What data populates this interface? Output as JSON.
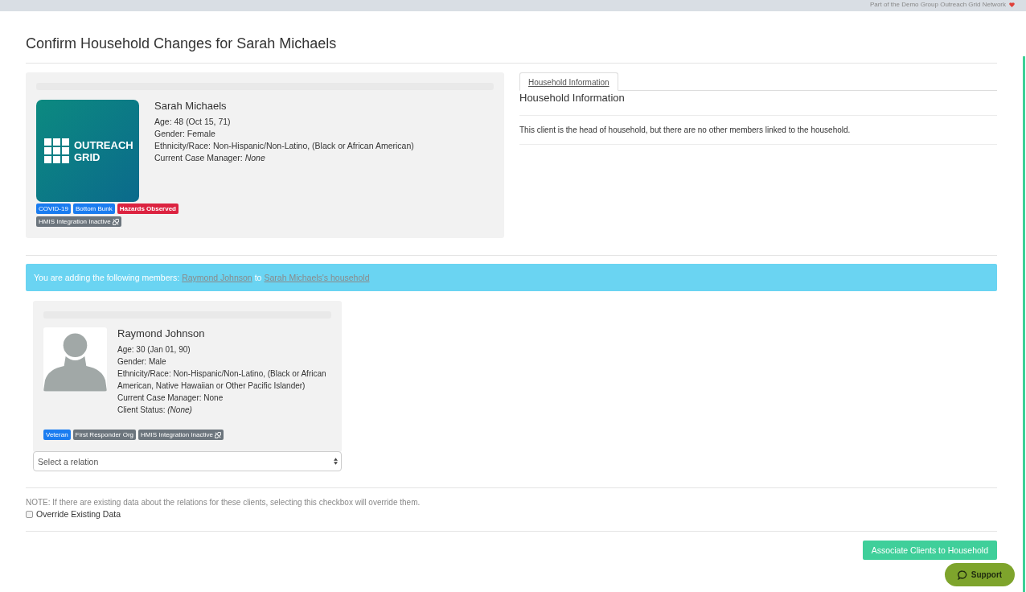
{
  "top_bar": {
    "text": "Part of the Demo Group Outreach Grid Network"
  },
  "title": "Confirm Household Changes for Sarah Michaels",
  "client": {
    "logo_lines": [
      "OUTREACH",
      "GRID"
    ],
    "name": "Sarah Michaels",
    "fields": [
      {
        "label": "Age:",
        "value": "48 (Oct 15, 71)",
        "italic": false
      },
      {
        "label": "Gender:",
        "value": "Female",
        "italic": false
      },
      {
        "label": "Ethnicity/Race:",
        "value": "Non-Hispanic/Non-Latino, (Black or African American)",
        "italic": false
      },
      {
        "label": "Current Case Manager:",
        "value": "None",
        "italic": true
      }
    ],
    "badges": [
      {
        "text": "COVID-19",
        "color": "#1a7cf0",
        "bold": false,
        "kind": "plain"
      },
      {
        "text": "Bottom Bunk",
        "color": "#1a7cf0",
        "bold": false,
        "kind": "plain"
      },
      {
        "text": "Hazards Observed",
        "color": "#dc2340",
        "bold": true,
        "kind": "plain"
      },
      {
        "text": "HMIS Integration Inactive",
        "color": "#6c757d",
        "bold": false,
        "kind": "unlinked"
      }
    ]
  },
  "household": {
    "tabs": [
      {
        "label": "Household Information",
        "selected": true
      }
    ],
    "heading": "Household Information",
    "message": "This client is the head of household, but there are no other members linked to the household."
  },
  "alert": {
    "text": "You are adding the following members:",
    "member_link": "Raymond Johnson",
    "joiner": "to",
    "household_link": "Sarah Michaels's household"
  },
  "members": [
    {
      "name": "Raymond Johnson",
      "fields": [
        {
          "label": "Age:",
          "value": "30 (Jan 01, 90)",
          "italic": false
        },
        {
          "label": "Gender:",
          "value": "Male",
          "italic": false
        },
        {
          "label": "Ethnicity/Race:",
          "value": "Non-Hispanic/Non-Latino, (Black or African American, Native Hawaiian or Other Pacific Islander)",
          "italic": false
        },
        {
          "label": "Current Case Manager:",
          "value": "None",
          "italic": false
        },
        {
          "label": "Client Status:",
          "value": "(None)",
          "italic": true
        }
      ],
      "badges": [
        {
          "text": "Veteran",
          "color": "#1a7cf0",
          "bold": false,
          "kind": "plain"
        },
        {
          "text": "First Responder Org",
          "color": "#6c757d",
          "bold": false,
          "kind": "plain"
        },
        {
          "text": "HMIS Integration Inactive",
          "color": "#6c757d",
          "bold": false,
          "kind": "unlinked"
        }
      ],
      "relation": {
        "placeholder": "Select a relation"
      }
    }
  ],
  "note": "NOTE: If there are existing data about the relations for these clients, selecting this checkbox will override them.",
  "override": {
    "label": "Override Existing Data",
    "checked": false
  },
  "submit": "Associate Clients to Household",
  "support": "Support"
}
